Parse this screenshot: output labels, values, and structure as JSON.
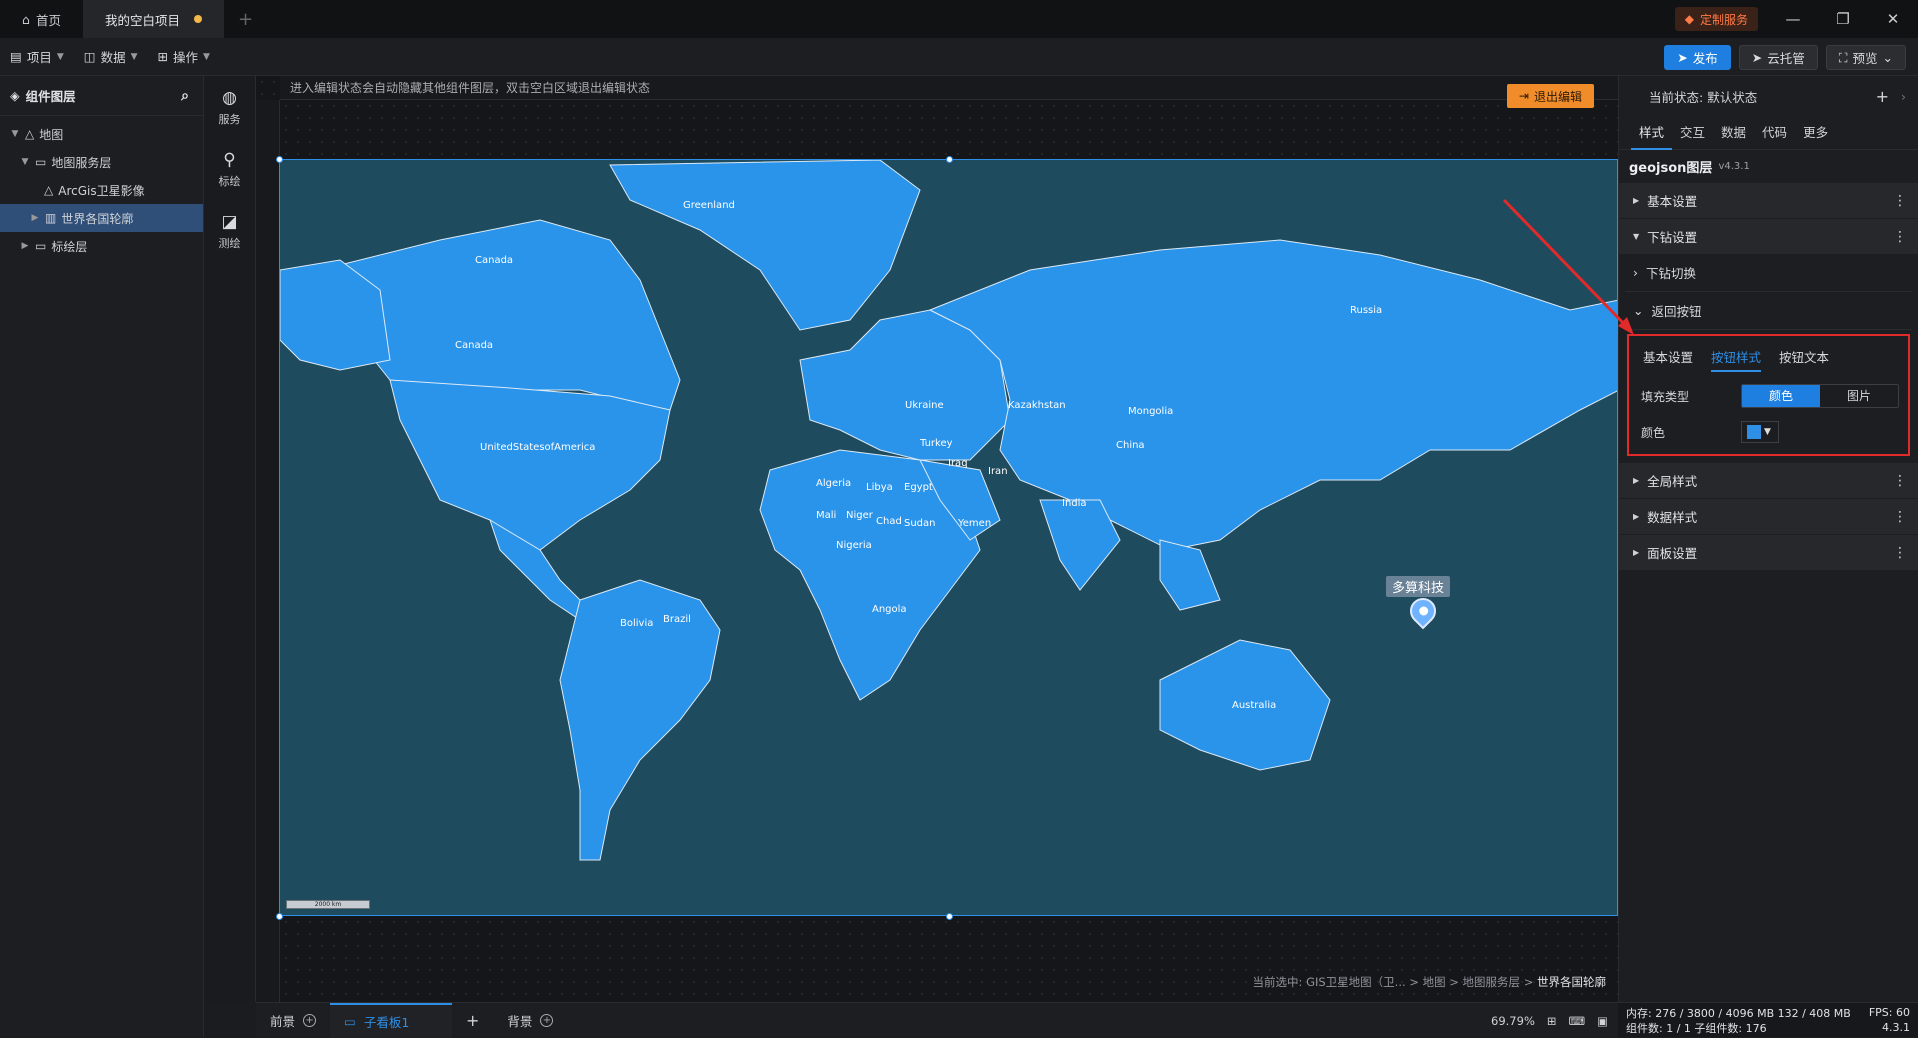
{
  "titlebar": {
    "tabs": [
      {
        "label": "首页"
      },
      {
        "label": "我的空白项目"
      }
    ],
    "custom_service": "定制服务"
  },
  "toolbar": {
    "menus": [
      "项目",
      "数据",
      "操作"
    ],
    "publish": "发布",
    "cloud": "云托管",
    "preview": "预览"
  },
  "left_panel": {
    "title": "组件图层",
    "tree": [
      "地图",
      "地图服务层",
      "ArcGis卫星影像",
      "世界各国轮廓",
      "标绘层"
    ]
  },
  "icon_bar": [
    "服务",
    "标绘",
    "测绘"
  ],
  "canvas": {
    "hint": "进入编辑状态会自动隐藏其他组件图层，双击空白区域退出编辑状态",
    "exit_edit": "退出编辑",
    "map_labels": {
      "greenland": "Greenland",
      "canada1": "Canada",
      "canada2": "Canada",
      "usa": "UnitedStatesofAmerica",
      "russia": "Russia",
      "ukraine": "Ukraine",
      "kazakhstan": "Kazakhstan",
      "mongolia": "Mongolia",
      "china": "China",
      "turkey": "Turkey",
      "iraq": "Iraq",
      "iran": "Iran",
      "algeria": "Algeria",
      "libya": "Libya",
      "egypt": "Egypt",
      "mali": "Mali",
      "niger": "Niger",
      "chad": "Chad",
      "sudan": "Sudan",
      "yemen": "Yemen",
      "nigeria": "Nigeria",
      "india": "India",
      "angola": "Angola",
      "brazil": "Brazil",
      "bolivia": "Bolivia",
      "australia": "Australia"
    },
    "scale_text": "2000 km",
    "pin_label": "多算科技",
    "breadcrumb_prefix": "当前选中: GIS卫星地图（卫... > 地图 > 地图服务层 > ",
    "breadcrumb_current": "世界各国轮廓"
  },
  "bottom_bar": {
    "front": "前景",
    "sub_board": "子看板1",
    "background": "背景",
    "zoom": "69.79%"
  },
  "right_panel": {
    "state_label": "当前状态:",
    "state_value": "默认状态",
    "tabs": [
      "样式",
      "交互",
      "数据",
      "代码",
      "更多"
    ],
    "component_name": "geojson图层",
    "component_version": "v4.3.1",
    "sections": {
      "basic": "基本设置",
      "drill": "下钻设置",
      "drill_switch": "下钻切换",
      "back_button": "返回按钮",
      "global_style": "全局样式",
      "data_style": "数据样式",
      "panel_settings": "面板设置"
    },
    "box": {
      "tabs": [
        "基本设置",
        "按钮样式",
        "按钮文本"
      ],
      "fill_type_label": "填充类型",
      "fill_options": [
        "颜色",
        "图片"
      ],
      "color_label": "颜色"
    }
  },
  "status": {
    "mem": "内存: 276 / 3800 / 4096 MB  132 / 408 MB",
    "fps": "FPS: 60",
    "counts": "组件数: 1 / 1   子组件数: 176",
    "version": "4.3.1"
  },
  "colors": {
    "accent": "#1f7fe0",
    "land": "#2a93ea",
    "ocean": "#1f4b5e",
    "highlight_box": "#e12a2a",
    "exit_button": "#f08c2a"
  }
}
